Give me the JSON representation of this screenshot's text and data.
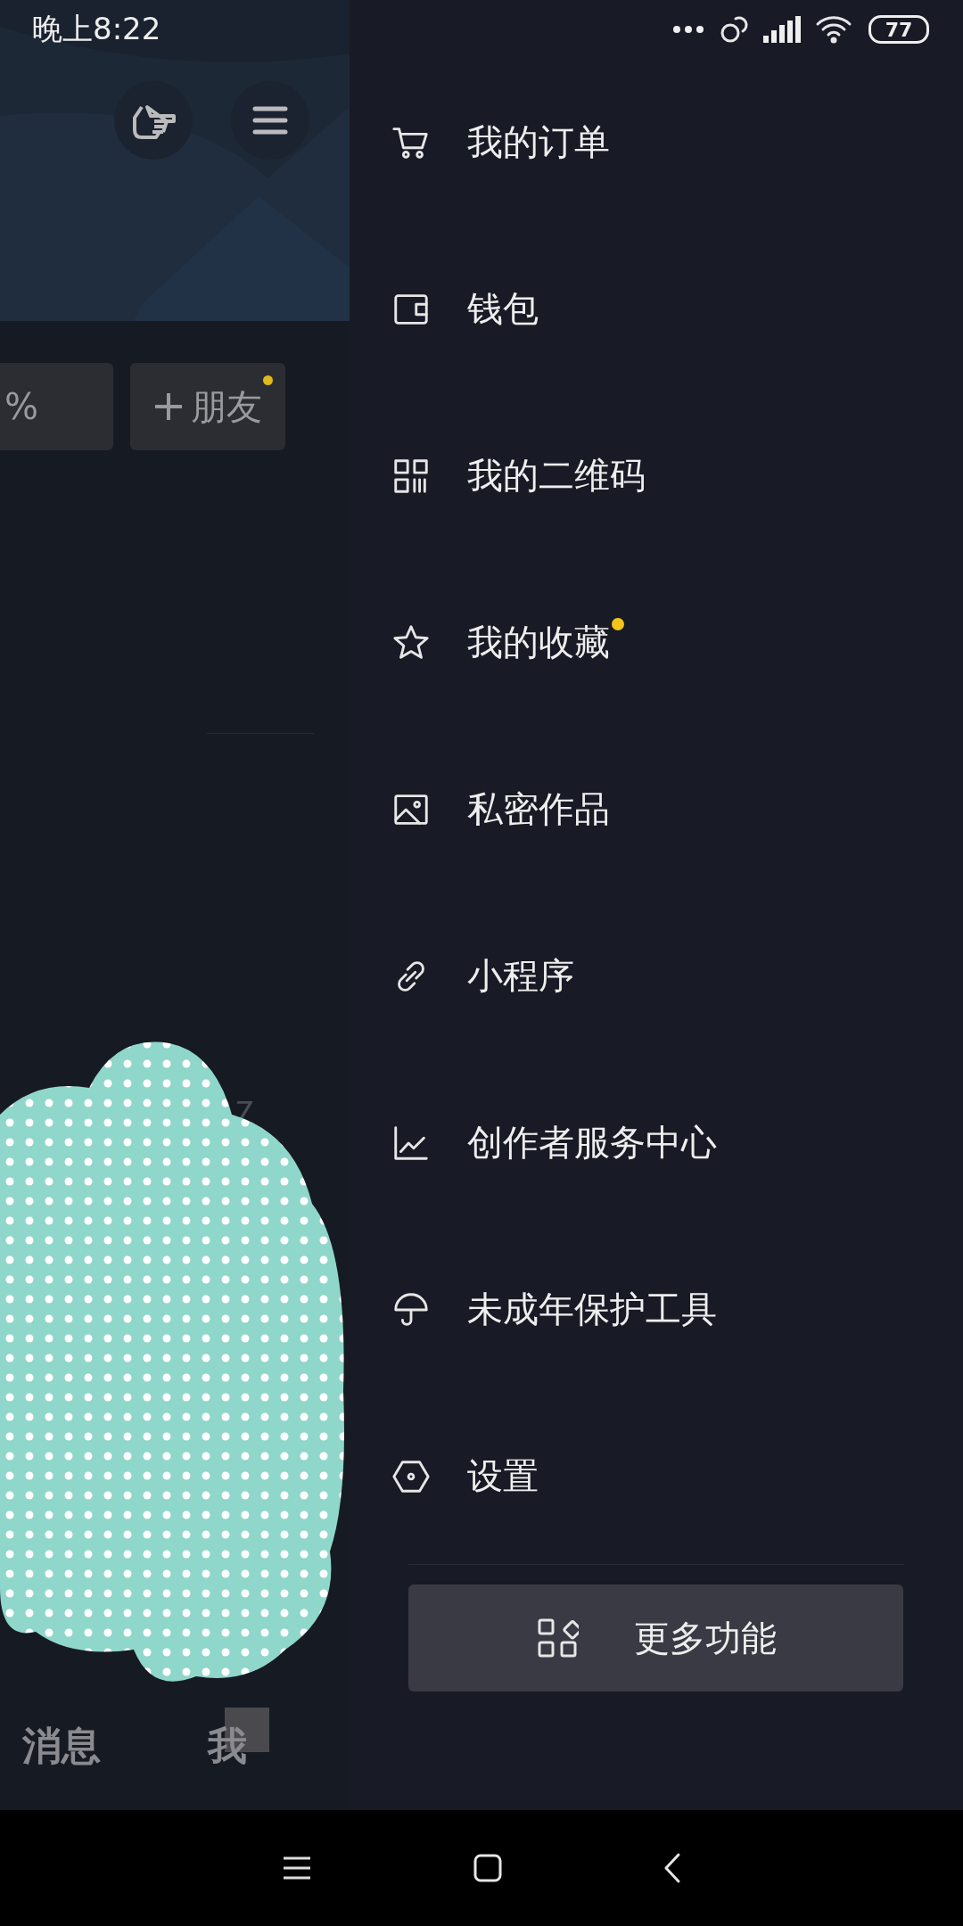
{
  "status_bar": {
    "time": "晚上8:22",
    "battery": "77"
  },
  "profile": {
    "actions": [
      {
        "label": "%",
        "dot": false
      },
      {
        "label": "朋友",
        "plus": true,
        "dot": true
      }
    ],
    "stray_digit": "7",
    "tabs": [
      {
        "label": "消息"
      },
      {
        "label": "我"
      }
    ]
  },
  "drawer": {
    "items": [
      {
        "kind": "cart",
        "label": "我的订单",
        "dot": false
      },
      {
        "kind": "wallet",
        "label": "钱包",
        "dot": false
      },
      {
        "kind": "qr",
        "label": "我的二维码",
        "dot": false
      },
      {
        "kind": "star",
        "label": "我的收藏",
        "dot": true
      },
      {
        "kind": "image",
        "label": "私密作品",
        "dot": false
      },
      {
        "kind": "link",
        "label": "小程序",
        "dot": false
      },
      {
        "kind": "chart",
        "label": "创作者服务中心",
        "dot": false
      },
      {
        "kind": "umbrella",
        "label": "未成年保护工具",
        "dot": false
      },
      {
        "kind": "settings",
        "label": "设置",
        "dot": false
      }
    ],
    "more_button": "更多功能"
  }
}
